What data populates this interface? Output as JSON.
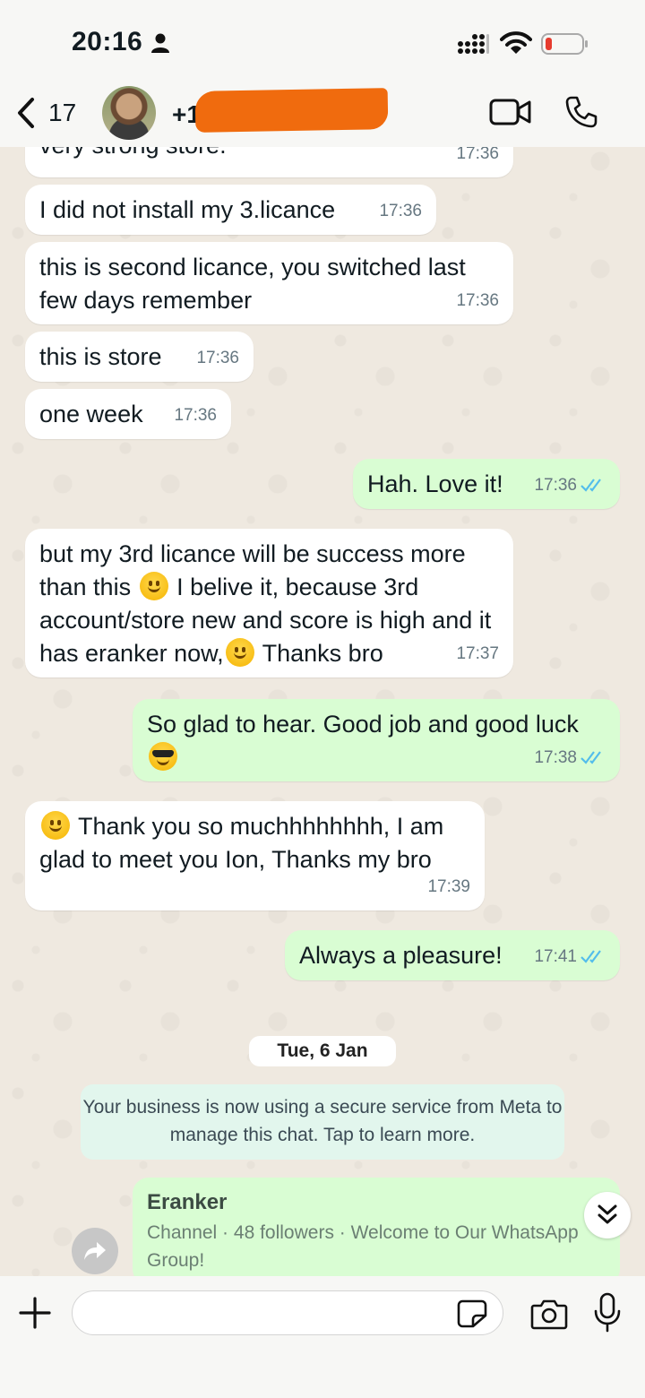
{
  "status_bar": {
    "time": "20:16"
  },
  "header": {
    "back_count": "17",
    "contact_name": "+1"
  },
  "messages": [
    {
      "dir": "in",
      "text": "very strong store.",
      "time": "17:36"
    },
    {
      "dir": "in",
      "text": "I did not install my 3.licance",
      "time": "17:36"
    },
    {
      "dir": "in",
      "text": "this is second licance, you switched last few days remember",
      "time": "17:36"
    },
    {
      "dir": "in",
      "text": "this is store",
      "time": "17:36"
    },
    {
      "dir": "in",
      "text": "one week",
      "time": "17:36"
    },
    {
      "dir": "out",
      "text": "Hah. Love it!",
      "time": "17:36"
    },
    {
      "dir": "in",
      "text_parts": [
        "but my 3rd licance will be success more than this",
        "I belive it, because 3rd account/store new and score is high and it has eranker now,",
        "Thanks bro"
      ],
      "time": "17:37"
    },
    {
      "dir": "out",
      "text": "So glad to hear. Good job and good luck",
      "time": "17:38"
    },
    {
      "dir": "in",
      "text": "Thank you so muchhhhhhhh, I am glad to meet you Ion, Thanks my bro",
      "time": "17:39"
    },
    {
      "dir": "out",
      "text": "Always a pleasure!",
      "time": "17:41"
    }
  ],
  "date_chip": "Tue, 6 Jan",
  "system_message": "Your business is now using a secure service from Meta to manage this chat. Tap to learn more.",
  "channel_card": {
    "title": "Eranker",
    "subtitle": "Channel · 48 followers · Welcome to Our WhatsApp Group!"
  },
  "composer": {
    "placeholder": ""
  },
  "colors": {
    "incoming": "#ffffff",
    "outgoing": "#d9fdd3",
    "read_ticks": "#53bdeb",
    "redaction": "#f06b0e"
  }
}
